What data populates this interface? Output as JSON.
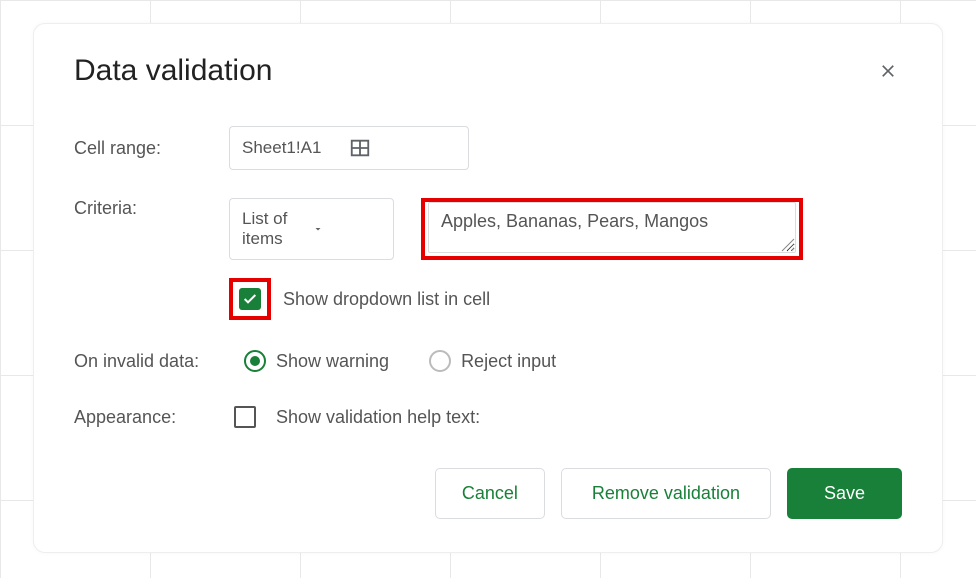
{
  "dialog": {
    "title": "Data validation",
    "cell_range_label": "Cell range:",
    "cell_range_value": "Sheet1!A1",
    "criteria_label": "Criteria:",
    "criteria_selected": "List of items",
    "criteria_items_value": "Apples, Bananas, Pears, Mangos",
    "show_dropdown_label": "Show dropdown list in cell",
    "invalid_label": "On invalid data:",
    "radio_show_warning": "Show warning",
    "radio_reject_input": "Reject input",
    "appearance_label": "Appearance:",
    "appearance_help_text": "Show validation help text:",
    "buttons": {
      "cancel": "Cancel",
      "remove": "Remove validation",
      "save": "Save"
    }
  }
}
